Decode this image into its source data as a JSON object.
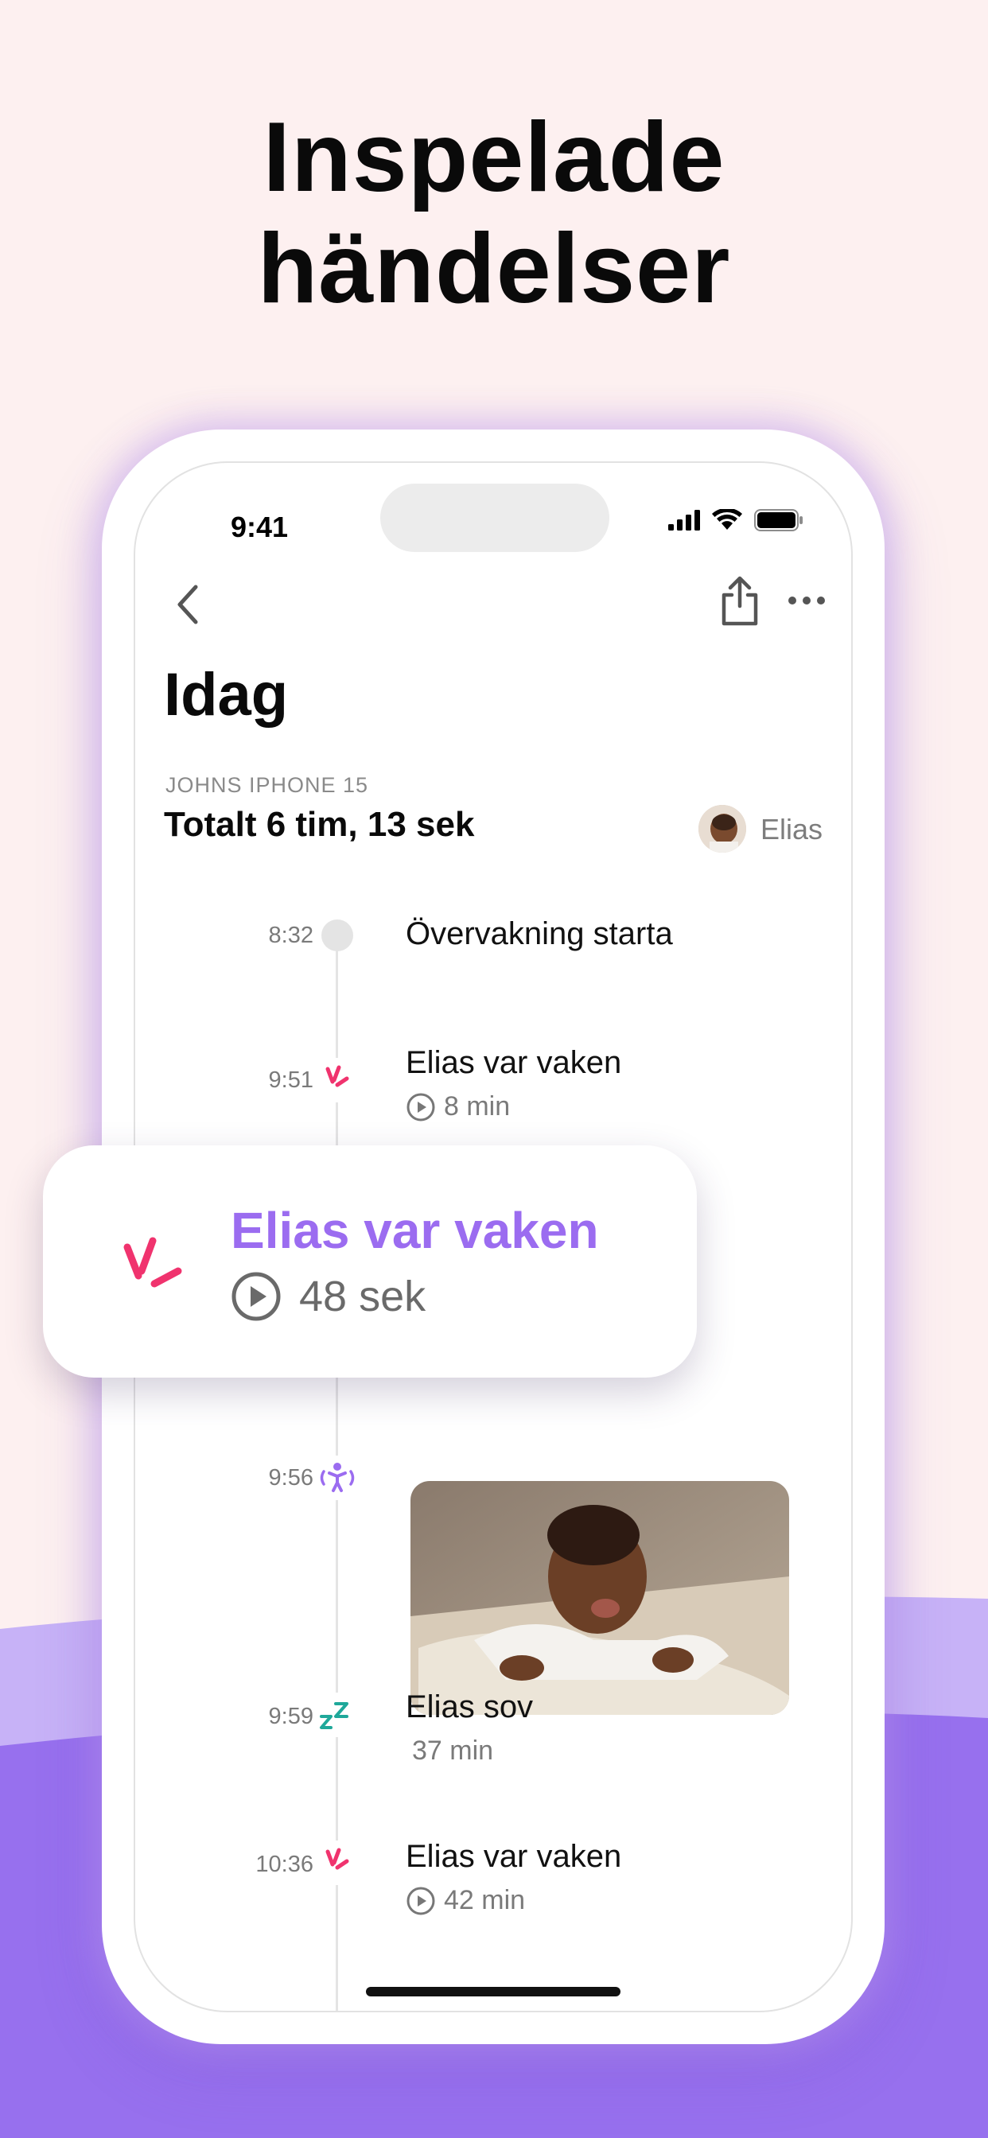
{
  "headline": {
    "line1": "Inspelade",
    "line2": "händelser"
  },
  "status_bar": {
    "time": "9:41"
  },
  "header": {
    "title": "Idag"
  },
  "summary": {
    "device": "JOHNS IPHONE 15",
    "total": "Totalt 6 tim, 13 sek",
    "child_name": "Elias"
  },
  "events": [
    {
      "time": "8:32",
      "title": "Övervakning starta",
      "icon": "dot-icon"
    },
    {
      "time": "9:51",
      "title": "Elias var vaken",
      "duration": "8 min",
      "icon": "awake-icon"
    },
    {
      "time": "9:56",
      "icon": "motion-icon"
    },
    {
      "time": "9:59",
      "title": "Elias sov",
      "duration": "37 min",
      "icon": "sleep-icon"
    },
    {
      "time": "10:36",
      "title": "Elias var vaken",
      "duration": "42 min",
      "icon": "awake-icon"
    }
  ],
  "highlight_card": {
    "title": "Elias var vaken",
    "duration": "48 sek"
  },
  "colors": {
    "accent_purple": "#9b6cf0",
    "awake_pink": "#f0336e",
    "sleep_teal": "#1fa89a",
    "background": "#fdf0f0"
  }
}
